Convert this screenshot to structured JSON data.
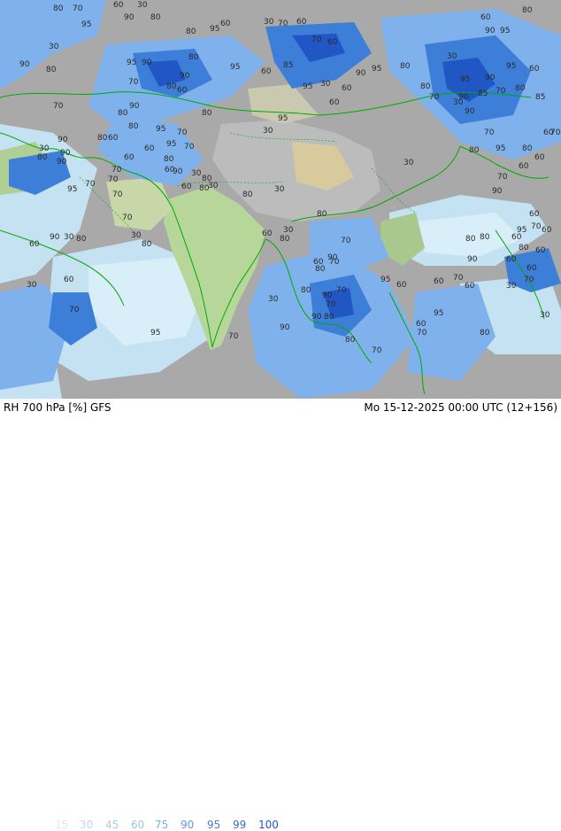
{
  "footer": {
    "title": "RH 700 hPa [%] GFS",
    "valid_time": "Mo 15-12-2025 00:00 UTC (12+156)"
  },
  "legend": [
    {
      "label": "15",
      "color": "#d8e8ff"
    },
    {
      "label": "30",
      "color": "#c2d8f4"
    },
    {
      "label": "45",
      "color": "#aecbee"
    },
    {
      "label": "60",
      "color": "#94c8ee"
    },
    {
      "label": "75",
      "color": "#79b3e6"
    },
    {
      "label": "90",
      "color": "#5e9be0"
    },
    {
      "label": "95",
      "color": "#3d7fd8"
    },
    {
      "label": "99",
      "color": "#3271d0"
    },
    {
      "label": "100",
      "color": "#2157c5"
    }
  ],
  "contour_labels": [
    "80",
    "70",
    "60",
    "30",
    "90",
    "80",
    "30",
    "70",
    "60",
    "60",
    "80",
    "95",
    "90",
    "95",
    "30",
    "80",
    "95",
    "60",
    "70",
    "60",
    "80",
    "95",
    "90",
    "95",
    "60",
    "85",
    "90",
    "95",
    "80",
    "30",
    "95",
    "60",
    "90",
    "80",
    "70",
    "90",
    "95",
    "30",
    "60",
    "80",
    "60",
    "80",
    "95",
    "90",
    "70",
    "80",
    "90",
    "85",
    "85",
    "70",
    "70",
    "80",
    "90",
    "80",
    "95",
    "60",
    "30",
    "90",
    "80",
    "95",
    "70",
    "90",
    "95",
    "80",
    "60",
    "70",
    "30",
    "30",
    "60",
    "30",
    "90",
    "60",
    "70",
    "60",
    "80",
    "60",
    "70",
    "80",
    "95",
    "80",
    "90",
    "80",
    "60",
    "70",
    "60",
    "90",
    "30",
    "80",
    "95",
    "70",
    "70",
    "70",
    "60",
    "80",
    "30",
    "80",
    "30",
    "70",
    "90",
    "60",
    "80",
    "70",
    "95",
    "60",
    "80",
    "80",
    "80",
    "60",
    "90",
    "30",
    "80",
    "60",
    "30",
    "80",
    "70",
    "60",
    "30",
    "80",
    "70",
    "60",
    "90",
    "60",
    "80",
    "70",
    "90",
    "60",
    "60",
    "30",
    "60",
    "95",
    "60",
    "60",
    "70",
    "60",
    "30",
    "70",
    "80",
    "90",
    "70",
    "30",
    "70",
    "90",
    "80",
    "70",
    "95",
    "30",
    "90",
    "60",
    "70",
    "80",
    "95",
    "70",
    "80",
    "70"
  ]
}
